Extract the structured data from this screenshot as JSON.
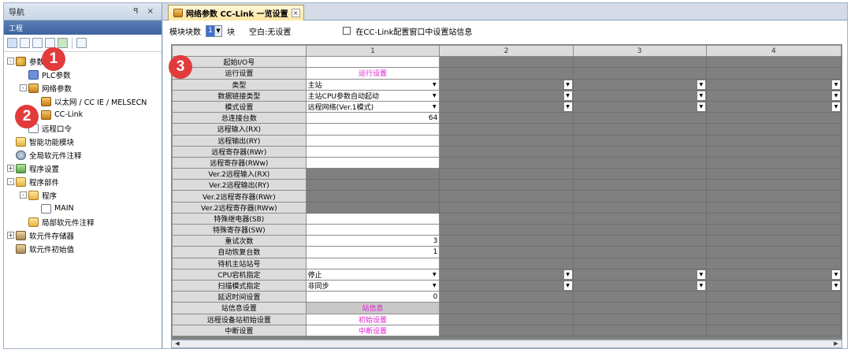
{
  "nav": {
    "title": "导航",
    "title_buttons": "ꟼ ×",
    "project_tab": "工程",
    "tree": [
      {
        "label": "参数",
        "indent": 0,
        "exp": "-",
        "icon": "param"
      },
      {
        "label": "PLC参数",
        "indent": 1,
        "exp": "",
        "icon": "plc"
      },
      {
        "label": "网络参数",
        "indent": 1,
        "exp": "-",
        "icon": "net"
      },
      {
        "label": "以太网 / CC IE / MELSECN",
        "indent": 2,
        "exp": "",
        "icon": "net"
      },
      {
        "label": "CC-Link",
        "indent": 2,
        "exp": "",
        "icon": "net"
      },
      {
        "label": "远程口令",
        "indent": 1,
        "exp": "",
        "icon": "doc"
      },
      {
        "label": "智能功能模块",
        "indent": 0,
        "exp": "",
        "icon": "folder"
      },
      {
        "label": "全局软元件注释",
        "indent": 0,
        "exp": "",
        "icon": "gear"
      },
      {
        "label": "程序设置",
        "indent": 0,
        "exp": "+",
        "icon": "green"
      },
      {
        "label": "程序部件",
        "indent": 0,
        "exp": "-",
        "icon": "folder"
      },
      {
        "label": "程序",
        "indent": 1,
        "exp": "-",
        "icon": "folder"
      },
      {
        "label": "MAIN",
        "indent": 2,
        "exp": "",
        "icon": "doc"
      },
      {
        "label": "局部软元件注释",
        "indent": 1,
        "exp": "",
        "icon": "folder"
      },
      {
        "label": "软元件存储器",
        "indent": 0,
        "exp": "+",
        "icon": "mem"
      },
      {
        "label": "软元件初始值",
        "indent": 0,
        "exp": "",
        "icon": "mem"
      }
    ]
  },
  "badges": [
    "1",
    "2",
    "3"
  ],
  "editor": {
    "tab_title": "网络参数 CC-Link 一览设置",
    "tab_close": "×",
    "module_count_label": "模块块数",
    "module_count_value": "1",
    "module_unit": "块",
    "blank_note": "空白:无设置",
    "station_info_checkbox_label": "在CC-Link配置窗口中设置站信息",
    "columns": [
      "1",
      "2",
      "3",
      "4"
    ],
    "rows": [
      {
        "label": "起始I/O号",
        "type": "w",
        "c1": ""
      },
      {
        "label": "运行设置",
        "type": "link",
        "c1": "运行设置"
      },
      {
        "label": "类型",
        "type": "sel",
        "c1": "主站"
      },
      {
        "label": "数据链接类型",
        "type": "sel",
        "c1": "主站CPU参数自动起动"
      },
      {
        "label": "模式设置",
        "type": "sel",
        "c1": "远程网络(Ver.1模式)"
      },
      {
        "label": "总连接台数",
        "type": "num",
        "c1": "64"
      },
      {
        "label": "远程输入(RX)",
        "type": "w",
        "c1": ""
      },
      {
        "label": "远程输出(RY)",
        "type": "w",
        "c1": ""
      },
      {
        "label": "远程寄存器(RWr)",
        "type": "w",
        "c1": ""
      },
      {
        "label": "远程寄存器(RWw)",
        "type": "w",
        "c1": ""
      },
      {
        "label": "Ver.2远程输入(RX)",
        "type": "g",
        "c1": ""
      },
      {
        "label": "Ver.2远程输出(RY)",
        "type": "g",
        "c1": ""
      },
      {
        "label": "Ver.2远程寄存器(RWr)",
        "type": "g",
        "c1": ""
      },
      {
        "label": "Ver.2远程寄存器(RWw)",
        "type": "g",
        "c1": ""
      },
      {
        "label": "特殊继电器(SB)",
        "type": "w",
        "c1": ""
      },
      {
        "label": "特殊寄存器(SW)",
        "type": "w",
        "c1": ""
      },
      {
        "label": "重试次数",
        "type": "num",
        "c1": "3"
      },
      {
        "label": "自动恢复台数",
        "type": "num",
        "c1": "1"
      },
      {
        "label": "待机主站站号",
        "type": "w",
        "c1": ""
      },
      {
        "label": "CPU宕机指定",
        "type": "sel",
        "c1": "停止"
      },
      {
        "label": "扫描模式指定",
        "type": "sel",
        "c1": "非同步"
      },
      {
        "label": "延迟时间设置",
        "type": "num",
        "c1": "0"
      },
      {
        "label": "站信息设置",
        "type": "link2",
        "c1": "站信息"
      },
      {
        "label": "远程设备站初始设置",
        "type": "link",
        "c1": "初始设置"
      },
      {
        "label": "中断设置",
        "type": "link",
        "c1": "中断设置"
      }
    ]
  },
  "colors": {
    "badge": "#e23b3b",
    "link_text": "#e020d0",
    "disabled_cell": "#808080"
  }
}
